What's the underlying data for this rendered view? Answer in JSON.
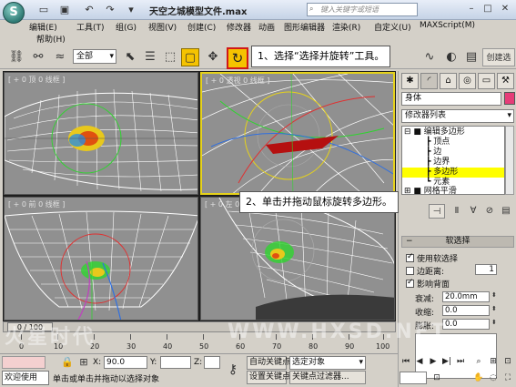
{
  "app": {
    "logo_letter": "S",
    "title": "天空之城模型文件.max",
    "search_placeholder": "键入关键字或短语",
    "quick_access": [
      "folder-open-icon",
      "save-icon",
      "undo-icon",
      "redo-icon"
    ],
    "window_controls": [
      "minimize-icon",
      "maximize-icon",
      "close-icon"
    ]
  },
  "menu": {
    "items": [
      "编辑(E)",
      "工具(T)",
      "组(G)",
      "视图(V)",
      "创建(C)",
      "修改器",
      "动画",
      "图形编辑器",
      "渲染(R)",
      "自定义(U)",
      "MAXScript(M)",
      "帮助(H)"
    ]
  },
  "toolbar": {
    "selection_filter": "全部",
    "callout_rotate": "1、选择“选择并旋转”工具。",
    "rotate_icon": "rotate-icon",
    "right_label": "创建选"
  },
  "viewports": {
    "top": "[ + 0 顶 0 线框 ]",
    "perspective": "[ + 0 透视 0 线框 ]",
    "front": "[ + 0 前 0 线框 ]",
    "left": "[ + 0 左 0 线框 ]",
    "callout_drag": "2、单击并拖动鼠标旋转多边形。"
  },
  "command_panel": {
    "object_name": "身体",
    "object_color": "#e63c78",
    "modifier_list": "修改器列表",
    "stack": [
      {
        "label": "编辑多边形",
        "selected": false
      },
      {
        "label": "顶点",
        "selected": false
      },
      {
        "label": "边",
        "selected": false
      },
      {
        "label": "边界",
        "selected": false
      },
      {
        "label": "多边形",
        "selected": true
      },
      {
        "label": "元素",
        "selected": false
      },
      {
        "label": "网格平滑",
        "selected": false
      }
    ],
    "soft_selection": {
      "title": "软选择",
      "use_soft": "使用软选择",
      "edge_distance": "边距离:",
      "edge_distance_value": "1",
      "affect_backfacing": "影响背面",
      "falloff_label": "衰减:",
      "falloff_value": "20.0mm",
      "pinch_label": "收缩:",
      "pinch_value": "0.0",
      "bubble_label": "膨胀:",
      "bubble_value": "0.0"
    }
  },
  "timeline": {
    "frame": "0 / 100",
    "ticks": [
      "0",
      "10",
      "20",
      "30",
      "40",
      "50",
      "60",
      "70",
      "80",
      "90",
      "100"
    ]
  },
  "status": {
    "welcome": "欢迎使用",
    "prompt": "单击或单击并拖动以选择对象",
    "x_label": "X:",
    "x_value": "90.0",
    "y_label": "Y:",
    "z_label": "Z:",
    "auto_key": "自动关键点",
    "set_key": "设置关键点",
    "selected_object": "选定对象",
    "key_filter": "关键点过滤器..."
  },
  "watermark": {
    "left": "火星时代",
    "right": "WWW.HXSD.NET"
  }
}
